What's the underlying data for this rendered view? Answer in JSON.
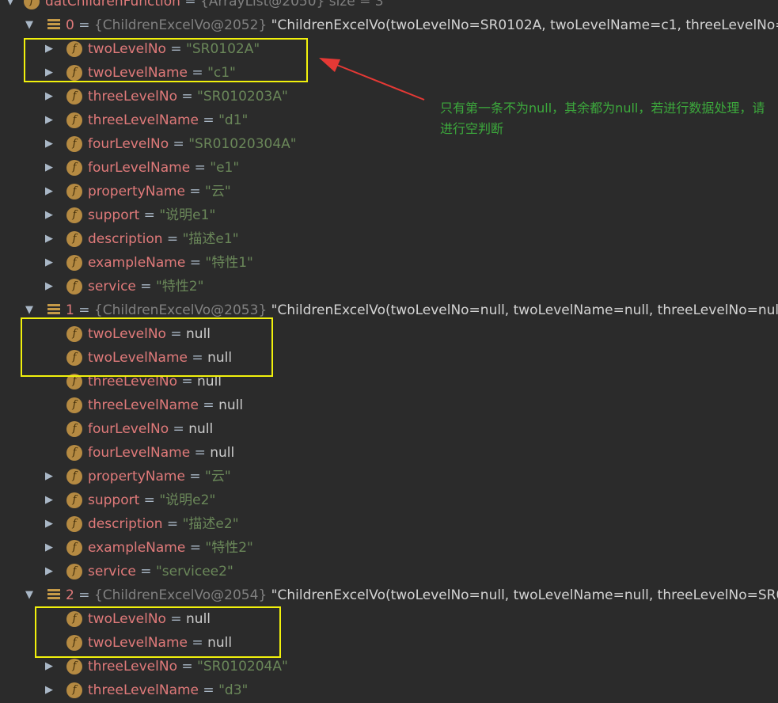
{
  "root": {
    "name": "datChildrenFunction",
    "eq": " = ",
    "ref": "{ArrayList@2050}",
    "size": " size = 3"
  },
  "items": [
    {
      "index": "0",
      "ref": "{ChildrenExcelVo@2052}",
      "summary": "\"ChildrenExcelVo(twoLevelNo=SR0102A, twoLevelName=c1, threeLevelNo=",
      "fields": [
        {
          "name": "twoLevelNo",
          "value": "\"SR0102A\"",
          "kind": "str"
        },
        {
          "name": "twoLevelName",
          "value": "\"c1\"",
          "kind": "str"
        },
        {
          "name": "threeLevelNo",
          "value": "\"SR010203A\"",
          "kind": "str"
        },
        {
          "name": "threeLevelName",
          "value": "\"d1\"",
          "kind": "str"
        },
        {
          "name": "fourLevelNo",
          "value": "\"SR01020304A\"",
          "kind": "str"
        },
        {
          "name": "fourLevelName",
          "value": "\"e1\"",
          "kind": "str"
        },
        {
          "name": "propertyName",
          "value": "\"云\"",
          "kind": "str"
        },
        {
          "name": "support",
          "value": "\"说明e1\"",
          "kind": "str"
        },
        {
          "name": "description",
          "value": "\"描述e1\"",
          "kind": "str"
        },
        {
          "name": "exampleName",
          "value": "\"特性1\"",
          "kind": "str"
        },
        {
          "name": "service",
          "value": "\"特性2\"",
          "kind": "str"
        }
      ]
    },
    {
      "index": "1",
      "ref": "{ChildrenExcelVo@2053}",
      "summary": "\"ChildrenExcelVo(twoLevelNo=null, twoLevelName=null, threeLevelNo=null",
      "fields": [
        {
          "name": "twoLevelNo",
          "value": "null",
          "kind": "null"
        },
        {
          "name": "twoLevelName",
          "value": "null",
          "kind": "null"
        },
        {
          "name": "threeLevelNo",
          "value": "null",
          "kind": "null"
        },
        {
          "name": "threeLevelName",
          "value": "null",
          "kind": "null"
        },
        {
          "name": "fourLevelNo",
          "value": "null",
          "kind": "null"
        },
        {
          "name": "fourLevelName",
          "value": "null",
          "kind": "null"
        },
        {
          "name": "propertyName",
          "value": "\"云\"",
          "kind": "str"
        },
        {
          "name": "support",
          "value": "\"说明e2\"",
          "kind": "str"
        },
        {
          "name": "description",
          "value": "\"描述e2\"",
          "kind": "str"
        },
        {
          "name": "exampleName",
          "value": "\"特性2\"",
          "kind": "str"
        },
        {
          "name": "service",
          "value": "\"servicee2\"",
          "kind": "str"
        }
      ]
    },
    {
      "index": "2",
      "ref": "{ChildrenExcelVo@2054}",
      "summary": "\"ChildrenExcelVo(twoLevelNo=null, twoLevelName=null, threeLevelNo=SR0",
      "fields": [
        {
          "name": "twoLevelNo",
          "value": "null",
          "kind": "null"
        },
        {
          "name": "twoLevelName",
          "value": "null",
          "kind": "null"
        },
        {
          "name": "threeLevelNo",
          "value": "\"SR010204A\"",
          "kind": "str"
        },
        {
          "name": "threeLevelName",
          "value": "\"d3\"",
          "kind": "str"
        }
      ]
    }
  ],
  "annotation": "只有第一条不为null，其余都为null，若进行数据处理，请进行空判断",
  "colors": {
    "background": "#2b2b2b",
    "field_name": "#e07a7a",
    "string_value": "#6a8759",
    "null_value": "#cccccc",
    "highlight_box": "#f1f10c",
    "arrow": "#e53935",
    "annotation": "#3ca93c"
  },
  "icons": {
    "field": "f",
    "expand": "▶",
    "collapse": "▼"
  }
}
